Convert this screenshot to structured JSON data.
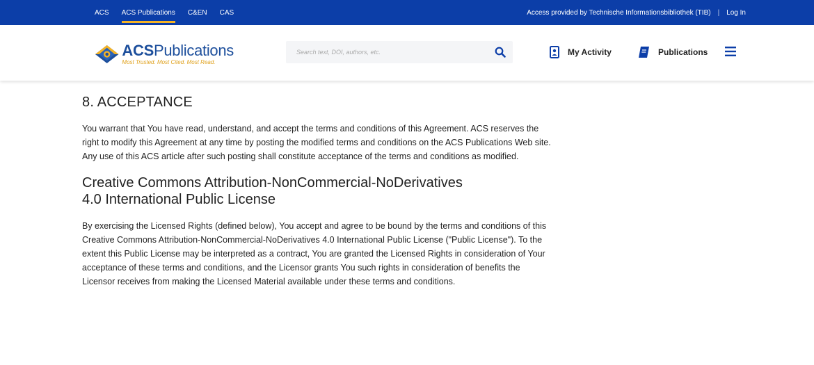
{
  "topbar": {
    "links": [
      "ACS",
      "ACS Publications",
      "C&EN",
      "CAS"
    ],
    "active_index": 1,
    "access_text": "Access provided by Technische Informationsbibliothek (TIB)",
    "login_label": "Log In",
    "bg_color": "#0c3ea8",
    "accent_color": "#f5b324"
  },
  "header": {
    "logo": {
      "brand_bold": "ACS",
      "brand_light": "Publications",
      "tagline": "Most Trusted. Most Cited. Most Read."
    },
    "search": {
      "placeholder": "Search text, DOI, authors, etc.",
      "icon": "search-icon"
    },
    "nav": {
      "my_activity": "My Activity",
      "publications": "Publications"
    }
  },
  "content": {
    "section_title": "8. ACCEPTANCE",
    "acceptance_text": "You warrant that You have read, understand, and accept the terms and conditions of this Agreement. ACS reserves the right to modify this Agreement at any time by posting the modified terms and conditions on the ACS Publications Web site. Any use of this ACS article after such posting shall constitute acceptance of the terms and conditions as modified.",
    "license_title": "Creative Commons Attribution-NonCommercial-NoDerivatives 4.0 International Public License",
    "license_text": "By exercising the Licensed Rights (defined below), You accept and agree to be bound by the terms and conditions of this Creative Commons Attribution-NonCommercial-NoDerivatives 4.0 International Public License (\"Public License\"). To the extent this Public License may be interpreted as a contract, You are granted the Licensed Rights in consideration of Your acceptance of these terms and conditions, and the Licensor grants You such rights in consideration of benefits the Licensor receives from making the Licensed Material available under these terms and conditions."
  }
}
